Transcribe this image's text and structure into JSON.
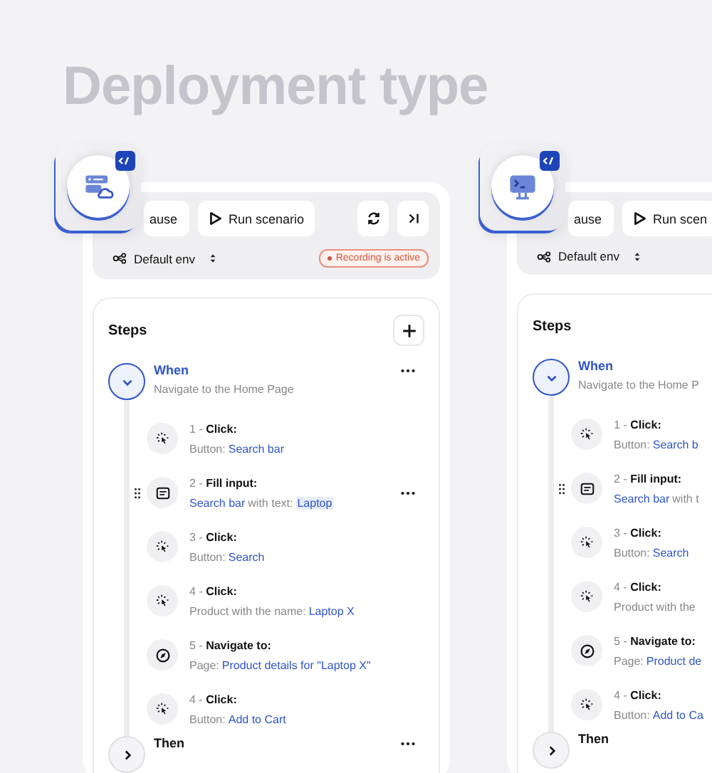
{
  "title": "Deployment type",
  "panels": [
    {
      "tile": {
        "kind": "server"
      },
      "toolbar": {
        "buttons": [
          {
            "kind": "pause",
            "label": "ause"
          },
          {
            "kind": "run",
            "label": "Run scenario"
          },
          {
            "kind": "refresh"
          },
          {
            "kind": "skip"
          }
        ],
        "env": "Default env",
        "recording": "Recording is active"
      },
      "steps": {
        "title": "Steps",
        "add_button": true,
        "groups": [
          {
            "title": "When",
            "subtitle": "Navigate to the Home Page",
            "expanded": true,
            "menu": true,
            "steps": [
              {
                "kind": "click",
                "number": "1 -",
                "action": "Click:",
                "drag_handle": false,
                "menu": false,
                "parts": [
                  {
                    "text": "Button:",
                    "link": false
                  },
                  {
                    "text": "Search bar",
                    "link": true
                  }
                ]
              },
              {
                "kind": "input",
                "number": "2 -",
                "action": "Fill input:",
                "drag_handle": true,
                "menu": true,
                "parts": [
                  {
                    "text": "Search bar",
                    "link": true
                  },
                  {
                    "text": "with text:",
                    "link": false
                  },
                  {
                    "text": "Laptop",
                    "link": true,
                    "highlighted": true
                  }
                ]
              },
              {
                "kind": "click",
                "number": "3 -",
                "action": "Click:",
                "drag_handle": false,
                "menu": false,
                "parts": [
                  {
                    "text": "Button:",
                    "link": false
                  },
                  {
                    "text": "Search",
                    "link": true
                  }
                ]
              },
              {
                "kind": "click",
                "number": "4 -",
                "action": "Click:",
                "drag_handle": false,
                "menu": false,
                "parts": [
                  {
                    "text": "Product with the name:",
                    "link": false
                  },
                  {
                    "text": "Laptop X",
                    "link": true
                  }
                ]
              },
              {
                "kind": "navigate",
                "number": "5 -",
                "action": "Navigate to:",
                "drag_handle": false,
                "menu": false,
                "parts": [
                  {
                    "text": "Page:",
                    "link": false
                  },
                  {
                    "text": "Product details for \"Laptop X\"",
                    "link": true
                  }
                ]
              },
              {
                "kind": "click",
                "number": "4 -",
                "action": "Click:",
                "drag_handle": false,
                "menu": false,
                "parts": [
                  {
                    "text": "Button:",
                    "link": false
                  },
                  {
                    "text": "Add to Cart",
                    "link": true
                  }
                ]
              }
            ]
          },
          {
            "title": "Then",
            "expanded": false,
            "menu": true
          }
        ]
      }
    },
    {
      "tile": {
        "kind": "terminal"
      },
      "toolbar": {
        "buttons": [
          {
            "kind": "pause",
            "label": "ause"
          },
          {
            "kind": "run",
            "label": "Run scen"
          }
        ],
        "env": "Default env"
      },
      "steps": {
        "title": "Steps",
        "groups": [
          {
            "title": "When",
            "subtitle": "Navigate to the Home P",
            "expanded": true,
            "steps": [
              {
                "kind": "click",
                "number": "1 -",
                "action": "Click:",
                "drag_handle": false,
                "parts": [
                  {
                    "text": "Button:",
                    "link": false
                  },
                  {
                    "text": "Search b",
                    "link": true
                  }
                ]
              },
              {
                "kind": "input",
                "number": "2 -",
                "action": "Fill input:",
                "drag_handle": true,
                "parts": [
                  {
                    "text": "Search bar",
                    "link": true
                  },
                  {
                    "text": "with t",
                    "link": false
                  }
                ]
              },
              {
                "kind": "click",
                "number": "3 -",
                "action": "Click:",
                "drag_handle": false,
                "parts": [
                  {
                    "text": "Button:",
                    "link": false
                  },
                  {
                    "text": "Search",
                    "link": true
                  }
                ]
              },
              {
                "kind": "click",
                "number": "4 -",
                "action": "Click:",
                "drag_handle": false,
                "parts": [
                  {
                    "text": "Product with the",
                    "link": false
                  }
                ]
              },
              {
                "kind": "navigate",
                "number": "5 -",
                "action": "Navigate to:",
                "drag_handle": false,
                "parts": [
                  {
                    "text": "Page:",
                    "link": false
                  },
                  {
                    "text": "Product de",
                    "link": true
                  }
                ]
              },
              {
                "kind": "click",
                "number": "4 -",
                "action": "Click:",
                "drag_handle": false,
                "parts": [
                  {
                    "text": "Button:",
                    "link": false
                  },
                  {
                    "text": "Add to Ca",
                    "link": true
                  }
                ]
              }
            ]
          },
          {
            "title": "Then",
            "expanded": false
          }
        ]
      }
    }
  ]
}
